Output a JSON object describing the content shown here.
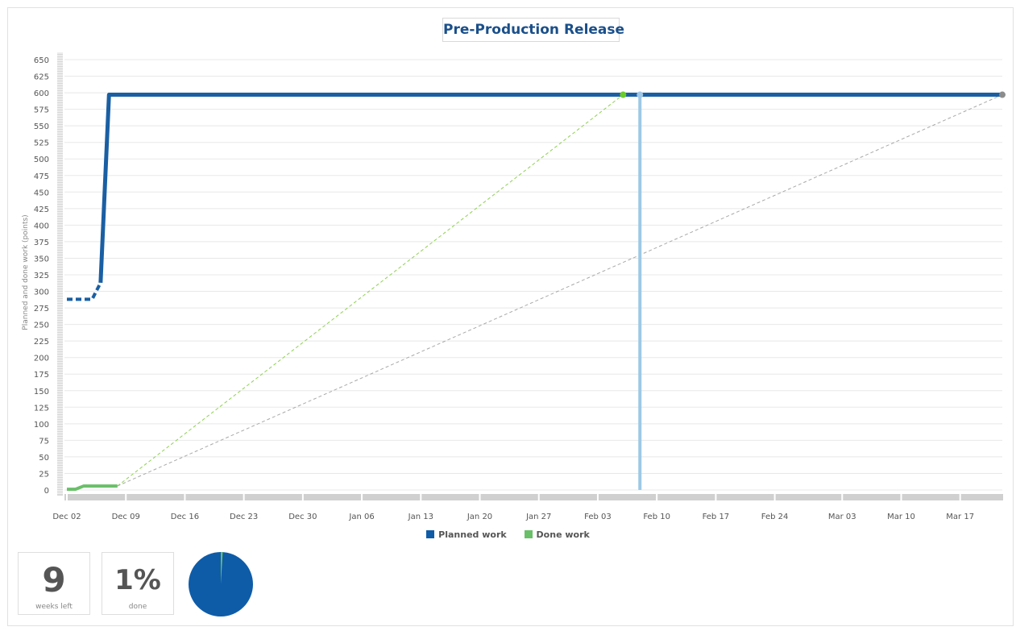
{
  "chart_data": {
    "type": "line",
    "title": "Pre-Production Release",
    "ylabel": "Planned and done work (points)",
    "xlabel": "",
    "ylim": [
      0,
      650
    ],
    "yticks": [
      0,
      25,
      50,
      75,
      100,
      125,
      150,
      175,
      200,
      225,
      250,
      275,
      300,
      325,
      350,
      375,
      400,
      425,
      450,
      475,
      500,
      525,
      550,
      575,
      600,
      625,
      650
    ],
    "xlim": [
      "2019-12-02",
      "2020-03-22"
    ],
    "xtick_dates": [
      "2019-12-02",
      "2019-12-09",
      "2019-12-16",
      "2019-12-23",
      "2019-12-30",
      "2020-01-06",
      "2020-01-13",
      "2020-01-20",
      "2020-01-27",
      "2020-02-03",
      "2020-02-10",
      "2020-02-17",
      "2020-02-24",
      "2020-03-03",
      "2020-03-10",
      "2020-03-17"
    ],
    "xtick_labels": [
      "Dec 02",
      "Dec 09",
      "Dec 16",
      "Dec 23",
      "Dec 30",
      "Jan 06",
      "Jan 13",
      "Jan 20",
      "Jan 27",
      "Feb 03",
      "Feb 10",
      "Feb 17",
      "Feb 24",
      "Mar 03",
      "Mar 10",
      "Mar 17"
    ],
    "grid": true,
    "legend": "bottom-center",
    "series": [
      {
        "name": "Planned work",
        "color": "#1a5fa3",
        "dashed_segment": [
          [
            "2019-12-02",
            288
          ],
          [
            "2019-12-05",
            288
          ],
          [
            "2019-12-06",
            313
          ]
        ],
        "points": [
          [
            "2019-12-06",
            313
          ],
          [
            "2019-12-07",
            597
          ],
          [
            "2020-03-22",
            597
          ]
        ]
      },
      {
        "name": "Done work",
        "color": "#6abf69",
        "points": [
          [
            "2019-12-02",
            1
          ],
          [
            "2019-12-03",
            1
          ],
          [
            "2019-12-04",
            6
          ],
          [
            "2019-12-08",
            6
          ]
        ]
      }
    ],
    "projections": [
      {
        "color": "#8dd14f",
        "from": [
          "2019-12-08",
          6
        ],
        "to": [
          "2020-02-06",
          597
        ]
      },
      {
        "color": "#a9a9a9",
        "from": [
          "2019-12-08",
          6
        ],
        "to": [
          "2020-03-22",
          597
        ]
      }
    ],
    "markers": [
      {
        "date": "2020-02-06",
        "value": 597,
        "color": "#6acc2b"
      },
      {
        "date": "2020-02-08",
        "value": 597,
        "color": "#9ec8e6"
      },
      {
        "date": "2020-03-22",
        "value": 597,
        "color": "#8c8c8c"
      }
    ],
    "today_line": {
      "date": "2020-02-08",
      "color": "#9ec8e6"
    }
  },
  "stats": {
    "weeks_left": {
      "value": "9",
      "label": "weeks left"
    },
    "done": {
      "value": "1%",
      "label": "done",
      "fraction": 0.01
    }
  },
  "pie": {
    "done_fraction": 0.01,
    "colors": {
      "remaining": "#0e5ca8",
      "done": "#6abf69"
    }
  }
}
